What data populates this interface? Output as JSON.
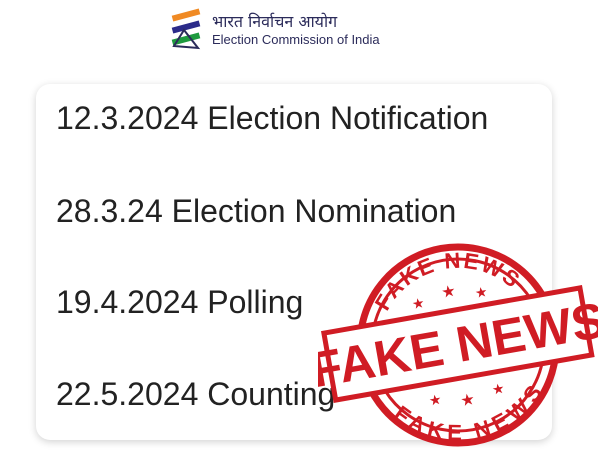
{
  "header": {
    "hindi_title": "भारत निर्वाचन आयोग",
    "english_title": "Election Commission of India",
    "logo_icon": "eci-ballot-logo-icon"
  },
  "message": {
    "lines": [
      "12.3.2024 Election Notification",
      "28.3.24 Election Nomination",
      "19.4.2024 Polling",
      "22.5.2024 Counting"
    ]
  },
  "stamp": {
    "main_text": "FAKE NEWS",
    "top_text": "FAKE NEWS",
    "bottom_text": "FAKE NEWS",
    "color": "#d01c24"
  }
}
